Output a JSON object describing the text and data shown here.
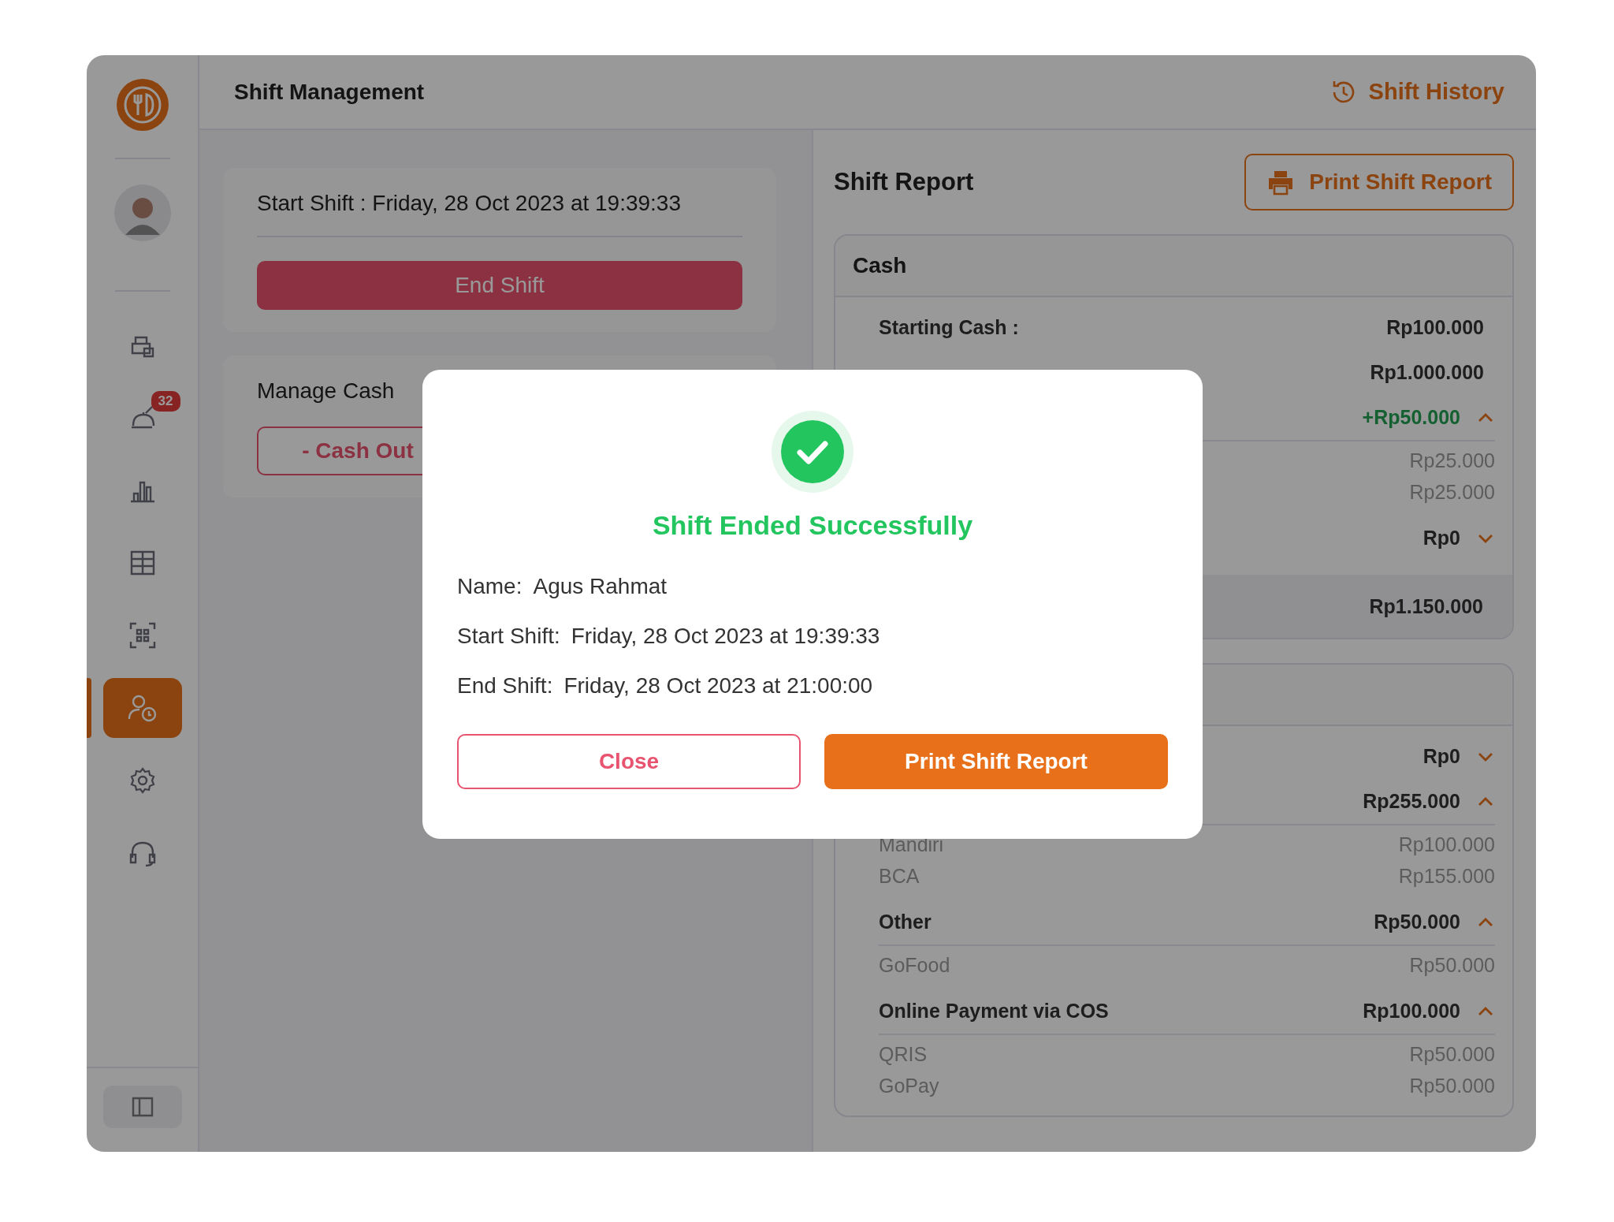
{
  "sidebar": {
    "items": [
      {
        "kind": "printer",
        "selected": false
      },
      {
        "kind": "dish",
        "selected": false,
        "badge": "32"
      },
      {
        "kind": "chart",
        "selected": false
      },
      {
        "kind": "table",
        "selected": false
      },
      {
        "kind": "qr",
        "selected": false
      },
      {
        "kind": "shift",
        "selected": true
      },
      {
        "kind": "gear",
        "selected": false
      },
      {
        "kind": "headset",
        "selected": false
      }
    ]
  },
  "header": {
    "title": "Shift Management",
    "history_link": "Shift History"
  },
  "shift_card": {
    "start_shift": "Start Shift : Friday, 28 Oct 2023 at 19:39:33",
    "end_button": "End Shift"
  },
  "manage_cash": {
    "title": "Manage Cash",
    "buttons": [
      "- Cash Out"
    ]
  },
  "report": {
    "title": "Shift Report",
    "print_button": "Print Shift Report",
    "cash": {
      "title": "Cash",
      "total": "Rp1.150.000",
      "rows": [
        {
          "kind": "row",
          "label": "Starting Cash :",
          "value": "Rp100.000"
        },
        {
          "kind": "row",
          "value": "Rp1.000.000"
        },
        {
          "kind": "group",
          "value": "+Rp50.000",
          "positive": true,
          "expanded": true
        },
        {
          "kind": "sub",
          "value": "Rp25.000"
        },
        {
          "kind": "sub",
          "value": "Rp25.000"
        },
        {
          "kind": "group",
          "value": "Rp0",
          "positive": false,
          "expanded": false
        }
      ]
    },
    "payments": {
      "rows": [
        {
          "kind": "group",
          "value": "Rp0",
          "positive": false,
          "expanded": false
        },
        {
          "kind": "group",
          "value": "Rp255.000",
          "positive": false,
          "expanded": true
        },
        {
          "kind": "sub",
          "label": "Mandiri",
          "value": "Rp100.000"
        },
        {
          "kind": "sub",
          "label": "BCA",
          "value": "Rp155.000"
        },
        {
          "kind": "group",
          "label": "Other",
          "value": "Rp50.000",
          "positive": false,
          "expanded": true
        },
        {
          "kind": "sub",
          "label": "GoFood",
          "value": "Rp50.000"
        },
        {
          "kind": "group",
          "label": "Online Payment via COS",
          "value": "Rp100.000",
          "positive": false,
          "expanded": true
        },
        {
          "kind": "sub",
          "label": "QRIS",
          "value": "Rp50.000"
        },
        {
          "kind": "sub",
          "label": "GoPay",
          "value": "Rp50.000"
        }
      ]
    }
  },
  "dialog": {
    "title": "Shift Ended Successfully",
    "fields": [
      {
        "label": "Name:",
        "value": "Agus Rahmat"
      },
      {
        "label": "Start Shift:",
        "value": "Friday, 28 Oct 2023 at 19:39:33"
      },
      {
        "label": "End Shift:",
        "value": "Friday, 28 Oct 2023 at 21:00:00"
      }
    ],
    "buttons": [
      {
        "kind": "secondary",
        "label": "Close"
      },
      {
        "kind": "primary",
        "label": "Print Shift Report"
      }
    ]
  }
}
